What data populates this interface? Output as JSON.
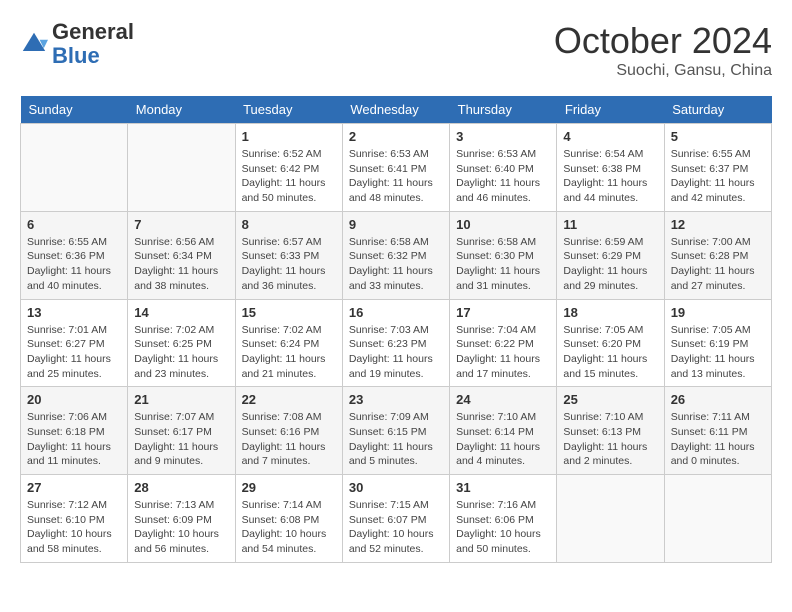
{
  "header": {
    "logo_general": "General",
    "logo_blue": "Blue",
    "month_year": "October 2024",
    "location": "Suochi, Gansu, China"
  },
  "weekdays": [
    "Sunday",
    "Monday",
    "Tuesday",
    "Wednesday",
    "Thursday",
    "Friday",
    "Saturday"
  ],
  "weeks": [
    [
      {
        "day": "",
        "info": ""
      },
      {
        "day": "",
        "info": ""
      },
      {
        "day": "1",
        "info": "Sunrise: 6:52 AM\nSunset: 6:42 PM\nDaylight: 11 hours and 50 minutes."
      },
      {
        "day": "2",
        "info": "Sunrise: 6:53 AM\nSunset: 6:41 PM\nDaylight: 11 hours and 48 minutes."
      },
      {
        "day": "3",
        "info": "Sunrise: 6:53 AM\nSunset: 6:40 PM\nDaylight: 11 hours and 46 minutes."
      },
      {
        "day": "4",
        "info": "Sunrise: 6:54 AM\nSunset: 6:38 PM\nDaylight: 11 hours and 44 minutes."
      },
      {
        "day": "5",
        "info": "Sunrise: 6:55 AM\nSunset: 6:37 PM\nDaylight: 11 hours and 42 minutes."
      }
    ],
    [
      {
        "day": "6",
        "info": "Sunrise: 6:55 AM\nSunset: 6:36 PM\nDaylight: 11 hours and 40 minutes."
      },
      {
        "day": "7",
        "info": "Sunrise: 6:56 AM\nSunset: 6:34 PM\nDaylight: 11 hours and 38 minutes."
      },
      {
        "day": "8",
        "info": "Sunrise: 6:57 AM\nSunset: 6:33 PM\nDaylight: 11 hours and 36 minutes."
      },
      {
        "day": "9",
        "info": "Sunrise: 6:58 AM\nSunset: 6:32 PM\nDaylight: 11 hours and 33 minutes."
      },
      {
        "day": "10",
        "info": "Sunrise: 6:58 AM\nSunset: 6:30 PM\nDaylight: 11 hours and 31 minutes."
      },
      {
        "day": "11",
        "info": "Sunrise: 6:59 AM\nSunset: 6:29 PM\nDaylight: 11 hours and 29 minutes."
      },
      {
        "day": "12",
        "info": "Sunrise: 7:00 AM\nSunset: 6:28 PM\nDaylight: 11 hours and 27 minutes."
      }
    ],
    [
      {
        "day": "13",
        "info": "Sunrise: 7:01 AM\nSunset: 6:27 PM\nDaylight: 11 hours and 25 minutes."
      },
      {
        "day": "14",
        "info": "Sunrise: 7:02 AM\nSunset: 6:25 PM\nDaylight: 11 hours and 23 minutes."
      },
      {
        "day": "15",
        "info": "Sunrise: 7:02 AM\nSunset: 6:24 PM\nDaylight: 11 hours and 21 minutes."
      },
      {
        "day": "16",
        "info": "Sunrise: 7:03 AM\nSunset: 6:23 PM\nDaylight: 11 hours and 19 minutes."
      },
      {
        "day": "17",
        "info": "Sunrise: 7:04 AM\nSunset: 6:22 PM\nDaylight: 11 hours and 17 minutes."
      },
      {
        "day": "18",
        "info": "Sunrise: 7:05 AM\nSunset: 6:20 PM\nDaylight: 11 hours and 15 minutes."
      },
      {
        "day": "19",
        "info": "Sunrise: 7:05 AM\nSunset: 6:19 PM\nDaylight: 11 hours and 13 minutes."
      }
    ],
    [
      {
        "day": "20",
        "info": "Sunrise: 7:06 AM\nSunset: 6:18 PM\nDaylight: 11 hours and 11 minutes."
      },
      {
        "day": "21",
        "info": "Sunrise: 7:07 AM\nSunset: 6:17 PM\nDaylight: 11 hours and 9 minutes."
      },
      {
        "day": "22",
        "info": "Sunrise: 7:08 AM\nSunset: 6:16 PM\nDaylight: 11 hours and 7 minutes."
      },
      {
        "day": "23",
        "info": "Sunrise: 7:09 AM\nSunset: 6:15 PM\nDaylight: 11 hours and 5 minutes."
      },
      {
        "day": "24",
        "info": "Sunrise: 7:10 AM\nSunset: 6:14 PM\nDaylight: 11 hours and 4 minutes."
      },
      {
        "day": "25",
        "info": "Sunrise: 7:10 AM\nSunset: 6:13 PM\nDaylight: 11 hours and 2 minutes."
      },
      {
        "day": "26",
        "info": "Sunrise: 7:11 AM\nSunset: 6:11 PM\nDaylight: 11 hours and 0 minutes."
      }
    ],
    [
      {
        "day": "27",
        "info": "Sunrise: 7:12 AM\nSunset: 6:10 PM\nDaylight: 10 hours and 58 minutes."
      },
      {
        "day": "28",
        "info": "Sunrise: 7:13 AM\nSunset: 6:09 PM\nDaylight: 10 hours and 56 minutes."
      },
      {
        "day": "29",
        "info": "Sunrise: 7:14 AM\nSunset: 6:08 PM\nDaylight: 10 hours and 54 minutes."
      },
      {
        "day": "30",
        "info": "Sunrise: 7:15 AM\nSunset: 6:07 PM\nDaylight: 10 hours and 52 minutes."
      },
      {
        "day": "31",
        "info": "Sunrise: 7:16 AM\nSunset: 6:06 PM\nDaylight: 10 hours and 50 minutes."
      },
      {
        "day": "",
        "info": ""
      },
      {
        "day": "",
        "info": ""
      }
    ]
  ]
}
